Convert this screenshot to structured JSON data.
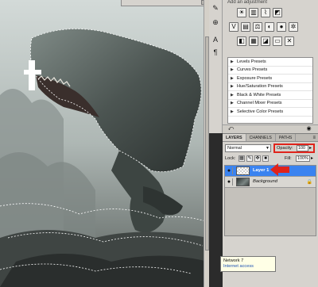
{
  "adjustments": {
    "header": "Add an adjustment",
    "icon_rows": [
      [
        "brightness-contrast-icon",
        "levels-icon",
        "curves-icon",
        "exposure-icon"
      ],
      [
        "vibrance-icon",
        "hue-saturation-icon",
        "color-balance-icon",
        "black-white-icon",
        "photo-filter-icon",
        "channel-mixer-icon"
      ],
      [
        "invert-icon",
        "posterize-icon",
        "threshold-icon",
        "gradient-map-icon",
        "selective-color-icon"
      ]
    ],
    "presets": [
      "Levels Presets",
      "Curves Presets",
      "Exposure Presets",
      "Hue/Saturation Presets",
      "Black & White Presets",
      "Channel Mixer Presets",
      "Selective Color Presets"
    ]
  },
  "layers_panel": {
    "tabs": [
      {
        "label": "LAYERS",
        "active": true
      },
      {
        "label": "CHANNELS",
        "active": false
      },
      {
        "label": "PATHS",
        "active": false
      }
    ],
    "blend_mode": "Normal",
    "opacity_label": "Opacity:",
    "opacity_value": "100",
    "lock_label": "Lock:",
    "fill_label": "Fill:",
    "fill_value": "100%",
    "layers": [
      {
        "name": "Layer 1",
        "selected": true,
        "visible": true,
        "locked": false
      },
      {
        "name": "Background",
        "selected": false,
        "visible": true,
        "locked": true
      }
    ]
  },
  "tooltip": {
    "title": "Network 7",
    "status": "Internet access"
  },
  "colors": {
    "highlight_red": "#e0231b",
    "selection_blue": "#3a83f0",
    "panel_bg": "#d6d3ce"
  }
}
